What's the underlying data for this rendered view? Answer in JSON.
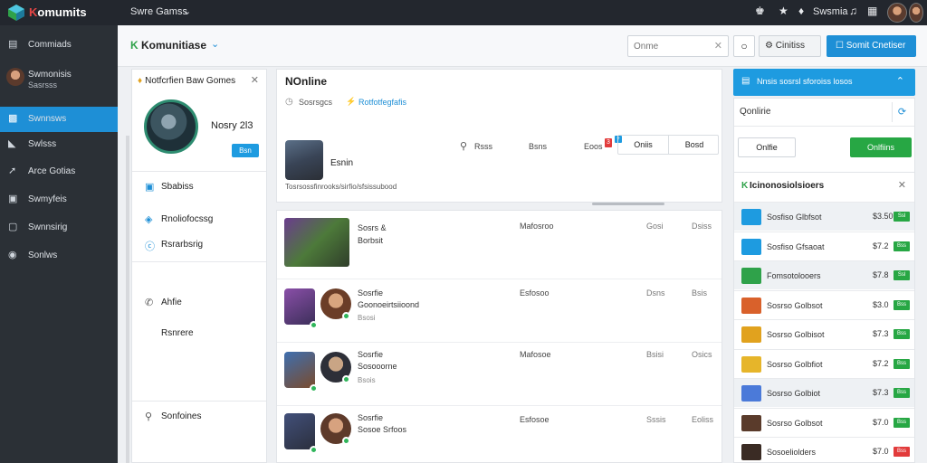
{
  "topbar": {
    "brand_k": "K",
    "brand_rest": "omumits",
    "menu_label": "Swre Gamss",
    "user_label": "Swsmia",
    "icons": [
      "puzzle-icon",
      "star-icon",
      "bell-icon",
      "music-icon",
      "grid-icon"
    ]
  },
  "sidebar": {
    "items": [
      {
        "label": "Commiads",
        "icon": "monitor-icon"
      },
      {
        "label": "Swnnsws",
        "icon": "folder-icon",
        "active": true
      },
      {
        "label": "Swlsss",
        "icon": "folder-open-icon"
      },
      {
        "label": "Arce Gotias",
        "icon": "cursor-icon"
      },
      {
        "label": "Swmyfeis",
        "icon": "window-icon"
      },
      {
        "label": "Swnnsirig",
        "icon": "box-icon"
      },
      {
        "label": "Sonlws",
        "icon": "globe-icon"
      }
    ],
    "profile": {
      "name": "Swmonisis",
      "sub": "Sasrsss"
    }
  },
  "section": {
    "title": "Komunitiase",
    "search_placeholder": "Onme",
    "icon_button_label": "○",
    "outline_button": "Cinitiss",
    "primary_button": "Somit Cnetiser"
  },
  "left_panel": {
    "header": "Notfcrfien Baw Gomes",
    "score": "Nosry 2l3",
    "badge": "Bsn",
    "items": [
      {
        "label": "Sbabiss",
        "icon": "card-icon"
      },
      {
        "label": "Rnoliofocssg",
        "icon": "tag-icon"
      },
      {
        "label": "Rsrarbsrig",
        "icon": "coin-icon"
      },
      {
        "label": "Ahfie",
        "icon": "phone-icon"
      },
      {
        "label": "Rsnrere",
        "icon": ""
      },
      {
        "label": "Sonfoines",
        "icon": "search-icon"
      }
    ]
  },
  "profile_card": {
    "title": "NOnline",
    "sub_left": "Sosrsgcs",
    "sub_link": "Rotfotfegfafis",
    "name": "Esnin",
    "description": "Tosrsossfinrooks/sirfio/sfsissubood",
    "tabs": [
      "Rsss",
      "Bsns",
      "Eoos"
    ],
    "tab_badge_red": "3",
    "tab_badge_blue": "+",
    "seg_left": "Oniis",
    "seg_right": "Bosd"
  },
  "list_rows": [
    {
      "title": "Sosrs &",
      "sub": "Borbsit",
      "sub2": "",
      "c1": "Mafosroo",
      "c2": "Gosi",
      "c3": "Dsiss"
    },
    {
      "title": "Sosrfie",
      "sub": "Goonoeirtsiioond",
      "sub2": "Bsosi",
      "c1": "Esfosoo",
      "c2": "Dsns",
      "c3": "Bsis"
    },
    {
      "title": "Sosrfie",
      "sub": "Sosooorne",
      "sub2": "Bsois",
      "c1": "Mafosoe",
      "c2": "Bsisi",
      "c3": "Osics"
    },
    {
      "title": "Sosrfie",
      "sub": "Sosoe Srfoos",
      "sub2": "",
      "c1": "Esfosoe",
      "c2": "Sssis",
      "c3": "Eoliss"
    }
  ],
  "right_panel": {
    "banner": "Nnsis sosrsl sforoiss losos",
    "search_value": "Qonlirie",
    "btn_outline": "Onlfie",
    "btn_green": "Onlfiins",
    "section_title": "Icinonosiolsioers",
    "friends": [
      {
        "name": "Sosfiso Glbfsot",
        "value": "$3.50",
        "badge": "Ssl",
        "badge_color": "#27a744",
        "icon_color": "#1e9be0",
        "alt": true
      },
      {
        "name": "Sosfiso Gfsaoat",
        "value": "$7.2",
        "badge": "Bss",
        "badge_color": "#27a744",
        "icon_color": "#1e9be0",
        "alt": false
      },
      {
        "name": "Fomsotolooers",
        "value": "$7.8",
        "badge": "Ssl",
        "badge_color": "#27a744",
        "icon_color": "#2fa24a",
        "alt": true
      },
      {
        "name": "Sosrso Golbsot",
        "value": "$3.0",
        "badge": "Bss",
        "badge_color": "#27a744",
        "icon_color": "#d9612b",
        "alt": false
      },
      {
        "name": "Sosrso Golbisot",
        "value": "$7.3",
        "badge": "Bss",
        "badge_color": "#27a744",
        "icon_color": "#e1a21e",
        "alt": false
      },
      {
        "name": "Sosrso Golbfiot",
        "value": "$7.2",
        "badge": "Bss",
        "badge_color": "#27a744",
        "icon_color": "#e6b52a",
        "alt": false
      },
      {
        "name": "Sosrso Golbiot",
        "value": "$7.3",
        "badge": "Bss",
        "badge_color": "#27a744",
        "icon_color": "#4b7ad9",
        "alt": true
      },
      {
        "name": "Sosrso Golbsot",
        "value": "$7.0",
        "badge": "Bss",
        "badge_color": "#27a744",
        "icon_color": "#5a3b2b",
        "alt": false
      },
      {
        "name": "Sosoeliolders",
        "value": "$7.0",
        "badge": "Bss",
        "badge_color": "#e23b3b",
        "icon_color": "#3a2b24",
        "alt": false
      }
    ]
  },
  "colors": {
    "accent": "#1e8fd6",
    "success": "#27a744",
    "danger": "#e23b3b",
    "topbar_bg": "#23272e",
    "sidebar_bg": "#2b3036"
  }
}
